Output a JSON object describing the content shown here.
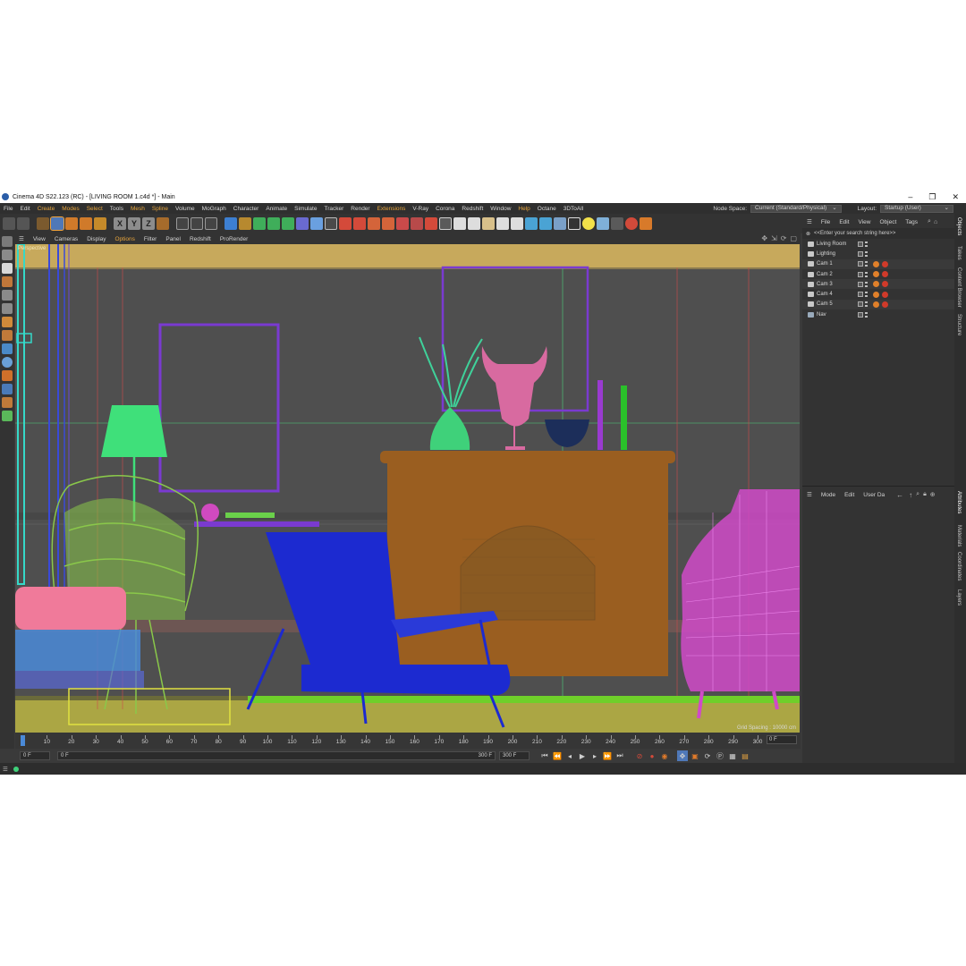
{
  "window": {
    "title": "Cinema 4D S22.123 (RC) - [LIVING ROOM 1.c4d *] - Main",
    "controls": [
      "–",
      "❐",
      "✕"
    ]
  },
  "menubar": {
    "items": [
      "File",
      "Edit",
      "Create",
      "Modes",
      "Select",
      "Tools",
      "Mesh",
      "Spline",
      "Volume",
      "MoGraph",
      "Character",
      "Animate",
      "Simulate",
      "Tracker",
      "Render",
      "Extensions",
      "V-Ray",
      "Corona",
      "Redshift",
      "Window",
      "Help",
      "Octane",
      "3DToAll"
    ],
    "highlighted": [
      "Create",
      "Modes",
      "Select",
      "Mesh",
      "Spline",
      "Extensions",
      "Help"
    ],
    "node_space_label": "Node Space:",
    "node_space_value": "Current (Standard/Physical)",
    "layout_label": "Layout:",
    "layout_value": "Startup (User)"
  },
  "toolbar": {
    "axis_buttons": [
      "X",
      "Y",
      "Z"
    ]
  },
  "viewport": {
    "menu": [
      "View",
      "Cameras",
      "Display",
      "Options",
      "Filter",
      "Panel",
      "Redshift",
      "ProRender"
    ],
    "highlighted": [
      "Options"
    ],
    "label": "Perspective",
    "grid_text": "Grid Spacing : 10000 cm"
  },
  "timeline": {
    "ticks": [
      "0",
      "10",
      "20",
      "30",
      "40",
      "50",
      "60",
      "70",
      "80",
      "90",
      "100",
      "110",
      "120",
      "130",
      "140",
      "150",
      "160",
      "170",
      "180",
      "190",
      "200",
      "210",
      "220",
      "230",
      "240",
      "250",
      "260",
      "270",
      "280",
      "290",
      "300"
    ],
    "current_frame_box": "0 F"
  },
  "transport": {
    "start_field": "0 F",
    "range_start": "0 F",
    "range_end": "300 F",
    "end_field": "300 F"
  },
  "object_manager": {
    "menu": [
      "File",
      "Edit",
      "View",
      "Object",
      "Tags"
    ],
    "search_placeholder": "<<Enter your search string here>>",
    "objects": [
      {
        "name": "Living Room",
        "type": "layer"
      },
      {
        "name": "Lighting",
        "type": "layer"
      },
      {
        "name": "Cam 1",
        "type": "camera"
      },
      {
        "name": "Cam 2",
        "type": "camera"
      },
      {
        "name": "Cam 3",
        "type": "camera"
      },
      {
        "name": "Cam 4",
        "type": "camera"
      },
      {
        "name": "Cam 5",
        "type": "camera"
      },
      {
        "name": "Nav",
        "type": "null"
      }
    ]
  },
  "attribute_manager": {
    "menu": [
      "Mode",
      "Edit",
      "User Da"
    ]
  },
  "side_tabs": {
    "top": [
      "Objects",
      "Takes",
      "Content Browser",
      "Structure"
    ],
    "bottom": [
      "Attributes",
      "Materials",
      "Coordinates",
      "Layers"
    ]
  },
  "colors": {
    "accent": "#e6a43c",
    "viewport_bg": "#505050",
    "panel_bg": "#333333"
  }
}
